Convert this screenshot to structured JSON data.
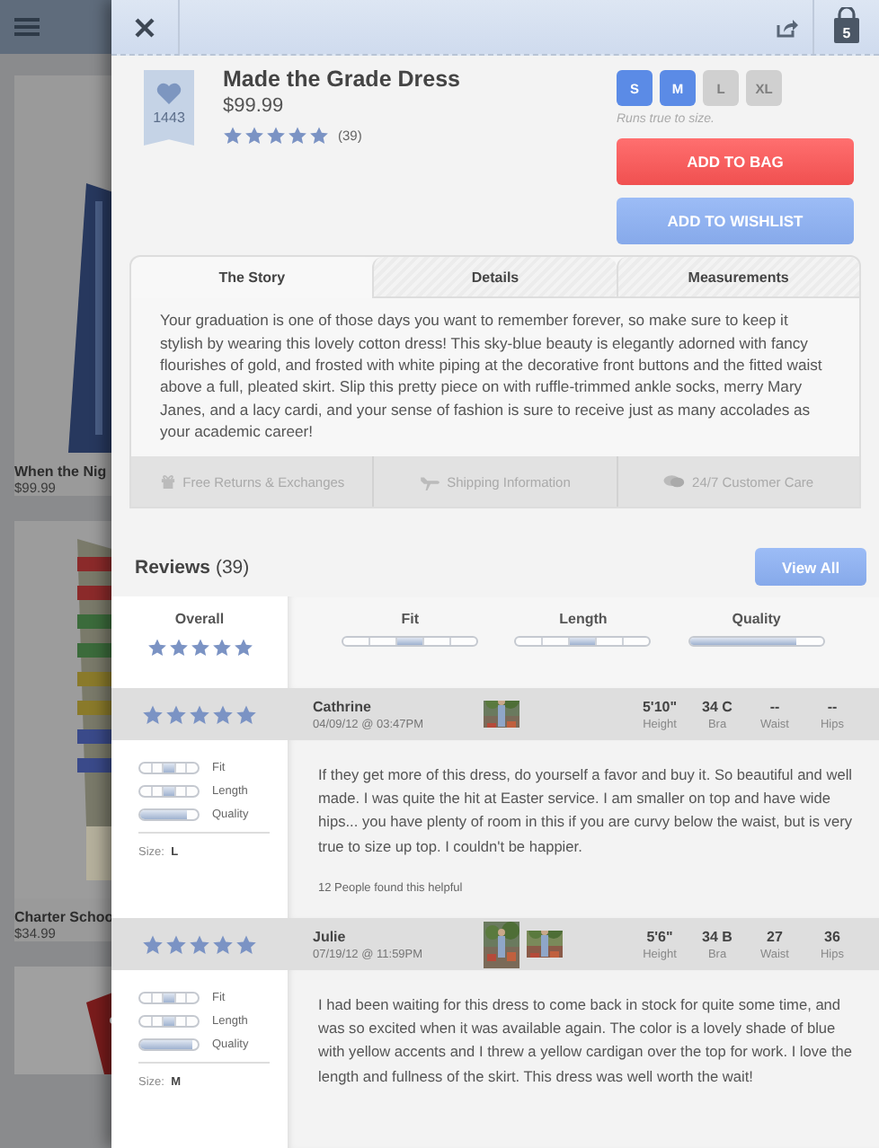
{
  "background": {
    "products": [
      {
        "name": "When the Nig",
        "price": "$99.99"
      },
      {
        "name": "Charter Schoo",
        "price": "$34.99"
      }
    ]
  },
  "topbar": {
    "bag_count": "5"
  },
  "product": {
    "likes": "1443",
    "title": "Made the Grade Dress",
    "price": "$99.99",
    "stars": 5,
    "review_count": "(39)",
    "sizes": [
      {
        "label": "S",
        "available": true
      },
      {
        "label": "M",
        "available": true
      },
      {
        "label": "L",
        "available": false
      },
      {
        "label": "XL",
        "available": false
      }
    ],
    "size_note": "Runs true to size.",
    "buttons": [
      {
        "label": "ADD TO BAG",
        "kind": "primary"
      },
      {
        "label": "ADD TO WISHLIST",
        "kind": "secondary"
      }
    ]
  },
  "tabs": [
    {
      "label": "The Story",
      "selected": true
    },
    {
      "label": "Details",
      "selected": false
    },
    {
      "label": "Measurements",
      "selected": false
    }
  ],
  "story": "Your graduation is one of those days you want to remember forever, so make sure to keep it stylish by wearing this lovely cotton dress! This sky-blue beauty is elegantly adorned with fancy flourishes of gold, and frosted with white piping at the decorative front buttons and the fitted waist above a full, pleated skirt. Slip this pretty piece on with ruffle-trimmed ankle socks, merry Mary Janes, and a lacy cardi, and your sense of fashion is sure to receive just as many accolades as your academic career!",
  "features": [
    {
      "label": "Free Returns & Exchanges",
      "kind": "gift"
    },
    {
      "label": "Shipping Information",
      "kind": "plane"
    },
    {
      "label": "24/7 Customer Care",
      "kind": "chat"
    }
  ],
  "reviews": {
    "title": "Reviews",
    "count": "(39)",
    "view_all": "View All",
    "summary": {
      "overall_label": "Overall",
      "stars": 5,
      "metrics": [
        {
          "label": "Fit",
          "kind": "scale",
          "level": 0.5
        },
        {
          "label": "Length",
          "kind": "scale",
          "level": 0.5
        },
        {
          "label": "Quality",
          "kind": "fill",
          "level": 0.8
        }
      ]
    },
    "items": [
      {
        "stars": 5,
        "name": "Cathrine",
        "date": "04/09/12 @ 03:47PM",
        "photos": [
          {
            "kind": "picture"
          }
        ],
        "measurements": [
          {
            "value": "5'10\"",
            "label": "Height"
          },
          {
            "value": "34 C",
            "label": "Bra"
          },
          {
            "value": "--",
            "label": "Waist"
          },
          {
            "value": "--",
            "label": "Hips"
          }
        ],
        "metrics": [
          {
            "label": "Fit",
            "kind": "scale",
            "level": 0.5
          },
          {
            "label": "Length",
            "kind": "scale",
            "level": 0.5
          },
          {
            "label": "Quality",
            "kind": "fill",
            "level": 0.8
          }
        ],
        "size_label": "Size:",
        "size": "L",
        "text": "If they get more of this dress, do yourself a favor and buy it. So beautiful and well made. I was quite the hit at Easter service. I am smaller on top and have wide hips... you have plenty of room in this if you are curvy below the waist, but is very true to size up top. I couldn't be happier.",
        "helpful": "12 People found this helpful"
      },
      {
        "stars": 5,
        "name": "Julie",
        "date": "07/19/12 @ 11:59PM",
        "photos": [
          {
            "kind": "picture"
          },
          {
            "kind": "picture"
          }
        ],
        "measurements": [
          {
            "value": "5'6\"",
            "label": "Height"
          },
          {
            "value": "34 B",
            "label": "Bra"
          },
          {
            "value": "27",
            "label": "Waist"
          },
          {
            "value": "36",
            "label": "Hips"
          }
        ],
        "metrics": [
          {
            "label": "Fit",
            "kind": "scale",
            "level": 0.5
          },
          {
            "label": "Length",
            "kind": "scale",
            "level": 0.5
          },
          {
            "label": "Quality",
            "kind": "fill",
            "level": 0.9
          }
        ],
        "size_label": "Size:",
        "size": "M",
        "text": "I had been waiting for this dress to come back in stock for quite some time, and was so excited when it was available again.  The color is a lovely shade of blue with yellow accents and I threw a yellow cardigan over the top for work.  I love the length and fullness of the skirt.  This dress was well worth the wait!"
      }
    ]
  }
}
